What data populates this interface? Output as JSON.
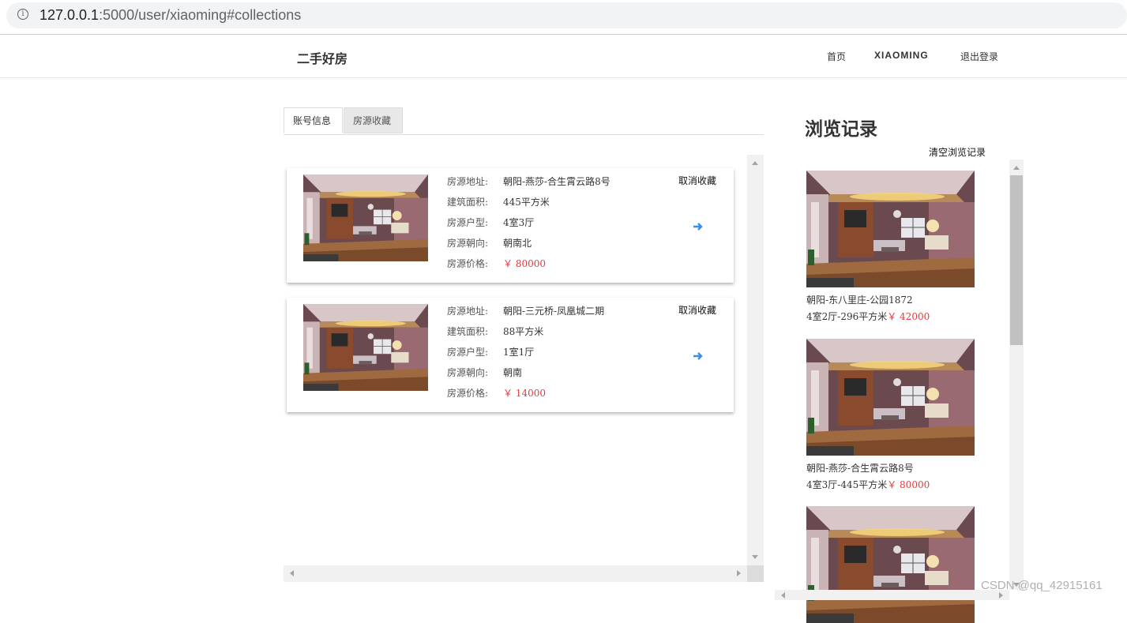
{
  "browser": {
    "url_host": "127.0.0.1",
    "url_rest": ":5000/user/xiaoming#collections"
  },
  "header": {
    "brand": "二手好房",
    "nav": {
      "home": "首页",
      "user": "XIAOMING",
      "logout": "退出登录"
    }
  },
  "tabs": {
    "account": "账号信息",
    "collections": "房源收藏"
  },
  "labels": {
    "address": "房源地址:",
    "area": "建筑面积:",
    "layout": "房源户型:",
    "orientation": "房源朝向:",
    "price": "房源价格:",
    "cancel": "取消收藏"
  },
  "collections": [
    {
      "address": "朝阳-燕莎-合生霄云路8号",
      "area": "445平方米",
      "layout": "4室3厅",
      "orientation": "朝南北",
      "price": "￥ 80000"
    },
    {
      "address": "朝阳-三元桥-凤凰城二期",
      "area": "88平方米",
      "layout": "1室1厅",
      "orientation": "朝南",
      "price": "￥ 14000"
    }
  ],
  "history": {
    "title": "浏览记录",
    "clear": "清空浏览记录",
    "items": [
      {
        "address": "朝阳-东八里庄-公园1872",
        "spec": "4室2厅-296平方米",
        "price": "￥ 42000"
      },
      {
        "address": "朝阳-燕莎-合生霄云路8号",
        "spec": "4室3厅-445平方米",
        "price": "￥ 80000"
      }
    ]
  },
  "watermark": "CSDN @qq_42915161",
  "colors": {
    "price": "#e4393c",
    "arrow": "#3a8ee6"
  }
}
